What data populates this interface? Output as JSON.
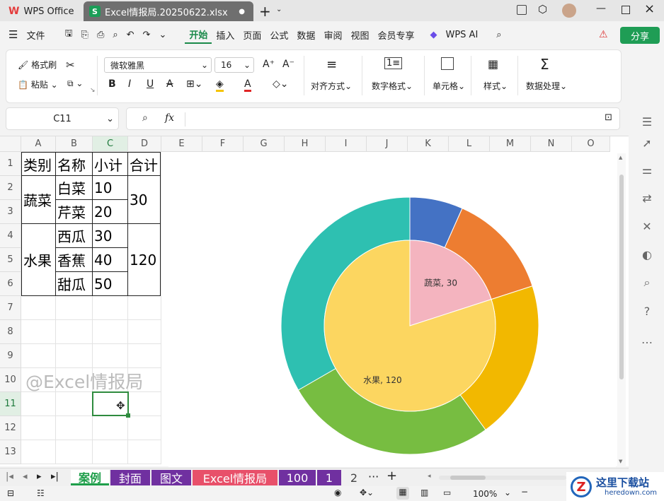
{
  "app": {
    "title": "WPS Office",
    "file_tab": "Excel情报局.20250622.xlsx",
    "file_icon": "S"
  },
  "menu": {
    "file": "文件",
    "items": [
      "开始",
      "插入",
      "页面",
      "公式",
      "数据",
      "审阅",
      "视图",
      "会员专享"
    ],
    "ai": "WPS AI",
    "share": "分享"
  },
  "ribbon": {
    "format_painter": "格式刷",
    "paste": "粘贴",
    "font_name": "微软雅黑",
    "font_size": "16",
    "align": "对齐方式",
    "number_format": "数字格式",
    "cell": "单元格",
    "style": "样式",
    "data_processing": "数据处理"
  },
  "formula": {
    "name_box": "C11",
    "fx": "fx"
  },
  "columns": [
    "A",
    "B",
    "C",
    "D",
    "E",
    "F",
    "G",
    "H",
    "I",
    "J",
    "K",
    "L",
    "M",
    "N",
    "O"
  ],
  "rows": [
    "1",
    "2",
    "3",
    "4",
    "5",
    "6",
    "7",
    "8",
    "9",
    "10",
    "11",
    "12",
    "13"
  ],
  "table": {
    "h1": "类别",
    "h2": "名称",
    "h3": "小计",
    "h4": "合计",
    "veg": "蔬菜",
    "fruit": "水果",
    "n1": "白菜",
    "n2": "芹菜",
    "n3": "西瓜",
    "n4": "香蕉",
    "n5": "甜瓜",
    "v1": "10",
    "v2": "20",
    "v3": "30",
    "v4": "40",
    "v5": "50",
    "t1": "30",
    "t2": "120"
  },
  "watermark": "@Excel情报局",
  "chart_data": {
    "type": "pie",
    "inner": {
      "categories": [
        "蔬菜",
        "水果"
      ],
      "values": [
        30,
        120
      ],
      "colors": [
        "#f4b4bf",
        "#fcd660"
      ],
      "labels": [
        "蔬菜, 30",
        "水果, 120"
      ]
    },
    "outer": {
      "categories": [
        "白菜",
        "芹菜",
        "西瓜",
        "香蕉",
        "甜瓜"
      ],
      "values": [
        10,
        20,
        30,
        40,
        50
      ],
      "colors": [
        "#4472c4",
        "#ed7d31",
        "#f2b800",
        "#77bd41",
        "#2ec0b1"
      ]
    }
  },
  "sheets": [
    "案例",
    "封面",
    "图文",
    "Excel情报局",
    "100",
    "1",
    "2"
  ],
  "sheet_colors": [
    "#ffffff",
    "#7030a0",
    "#7030a0",
    "#e8506a",
    "#7030a0",
    "#7030a0",
    "#f0f0f0"
  ],
  "status": {
    "zoom": "100%"
  },
  "logo": {
    "site": "这里下载站",
    "url": "heredown.com"
  }
}
